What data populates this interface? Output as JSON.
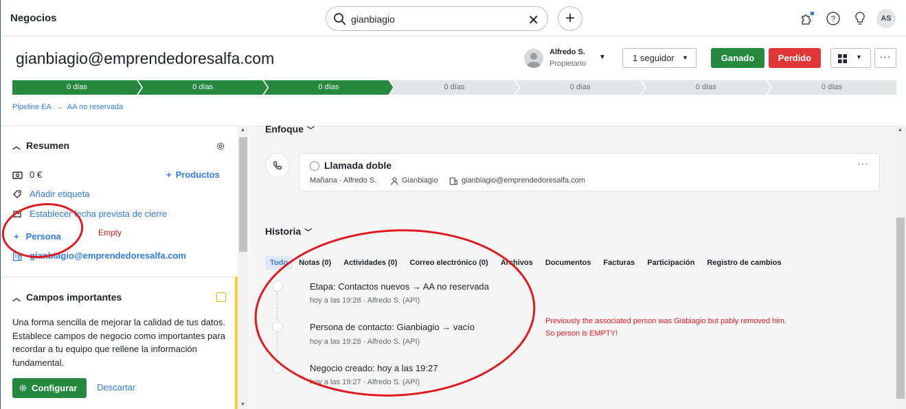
{
  "app": {
    "title": "Negocios"
  },
  "search": {
    "value": "gianbiagio"
  },
  "user": {
    "initials": "AS"
  },
  "deal": {
    "title": "gianbiagio@emprendedoresalfa.com",
    "owner_name": "Alfredo S.",
    "owner_role": "Propietario",
    "followers_label": "1 seguidor",
    "won_label": "Ganado",
    "lost_label": "Perdido"
  },
  "pipeline": {
    "stages": [
      {
        "label": "0 días",
        "done": true
      },
      {
        "label": "0 días",
        "done": true
      },
      {
        "label": "0 días",
        "done": true
      },
      {
        "label": "0 días",
        "done": false
      },
      {
        "label": "0 días",
        "done": false
      },
      {
        "label": "0 días",
        "done": false
      },
      {
        "label": "0 días",
        "done": false
      }
    ],
    "breadcrumb": [
      "Pipeline EA",
      "AA no reservada"
    ]
  },
  "summary": {
    "title": "Resumen",
    "value": "0 €",
    "products_label": "Productos",
    "add_tag": "Añadir etiqueta",
    "close_date": "Establecer fecha prevista de cierre",
    "person": "Persona",
    "org": "gianbiagio@emprendedoresalfa.com"
  },
  "important_fields": {
    "title": "Campos importantes",
    "text": "Una forma sencilla de mejorar la calidad de tus datos. Establece campos de negocio como importantes para recordar a tu equipo que rellene la información fundamental.",
    "configure_label": "Configurar",
    "dismiss_label": "Descartar"
  },
  "focus": {
    "title": "Enfoque",
    "activity": {
      "title": "Llamada doble",
      "when": "Mañana · Alfredo S.",
      "person": "Gianbiagio",
      "org": "gianbiagio@emprendedoresalfa.com"
    }
  },
  "history": {
    "title": "Historia",
    "tabs": [
      "Todo",
      "Notas (0)",
      "Actividades (0)",
      "Correo electrónico (0)",
      "Archivos",
      "Documentos",
      "Facturas",
      "Participación",
      "Registro de cambios"
    ],
    "items": [
      {
        "text": "Etapa: Contactos nuevos → AA no reservada",
        "meta": "hoy a las 19:28 · Alfredo S. (API)"
      },
      {
        "text": "Persona de contacto: Gianbiagio → vacío",
        "meta": "hoy a las 19:28 · Alfredo S. (API)"
      },
      {
        "text": "Negocio creado: hoy a las 19:27",
        "meta": "hoy a las 19:27 · Alfredo S. (API)"
      }
    ]
  },
  "annotations": {
    "empty": "Empty",
    "note_line1": "Previously the associated person was Giabiagio but pably removed him.",
    "note_line2": "So person is EMPTY!"
  },
  "colors": {
    "green": "#25883f",
    "red": "#e03636",
    "link": "#317ae2",
    "annotation": "#e0191f"
  }
}
